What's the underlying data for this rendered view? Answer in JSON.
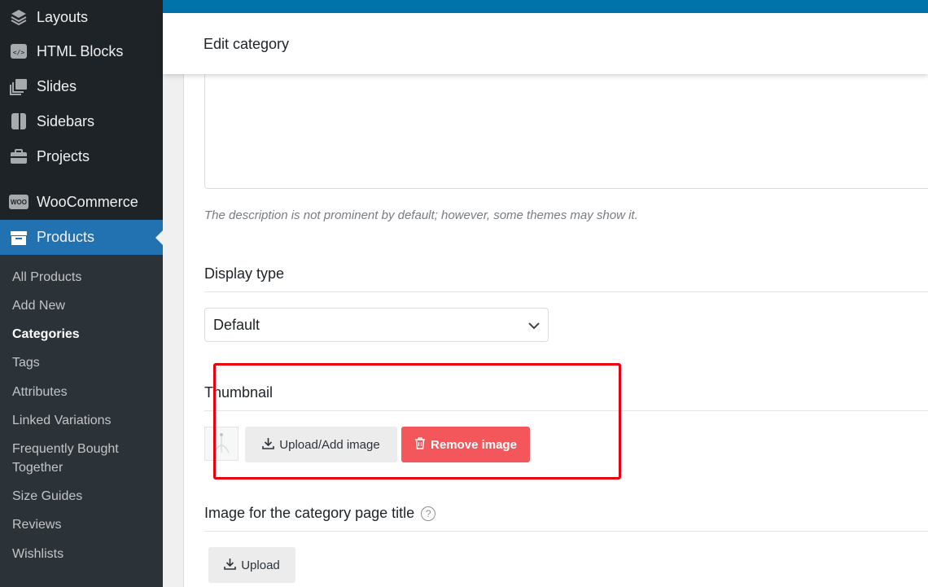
{
  "sidebar": {
    "items": [
      {
        "label": "Layouts",
        "icon": "layers-icon"
      },
      {
        "label": "HTML Blocks",
        "icon": "code-block-icon"
      },
      {
        "label": "Slides",
        "icon": "slides-icon"
      },
      {
        "label": "Sidebars",
        "icon": "sidebar-icon"
      },
      {
        "label": "Projects",
        "icon": "briefcase-icon"
      },
      {
        "label": "WooCommerce",
        "icon": "woo-icon",
        "icon_text": "WOO"
      },
      {
        "label": "Products",
        "icon": "archive-icon",
        "active": true
      }
    ],
    "submenu": [
      {
        "label": "All Products"
      },
      {
        "label": "Add New"
      },
      {
        "label": "Categories",
        "current": true
      },
      {
        "label": "Tags"
      },
      {
        "label": "Attributes"
      },
      {
        "label": "Linked Variations"
      },
      {
        "label": "Frequently Bought Together"
      },
      {
        "label": "Size Guides"
      },
      {
        "label": "Reviews"
      },
      {
        "label": "Wishlists"
      }
    ]
  },
  "header": {
    "title": "Edit category"
  },
  "form": {
    "description_hint": "The description is not prominent by default; however, some themes may show it.",
    "display_type": {
      "label": "Display type",
      "value": "Default"
    },
    "thumbnail": {
      "label": "Thumbnail",
      "upload_label": "Upload/Add image",
      "remove_label": "Remove image"
    },
    "title_image": {
      "label": "Image for the category page title",
      "help": "?",
      "upload_label": "Upload"
    }
  },
  "colors": {
    "sidebar_bg": "#1d2327",
    "active_menu": "#2271b1",
    "topbar": "#0073aa",
    "remove_button": "#f4575b",
    "highlight": "#e8000f"
  }
}
